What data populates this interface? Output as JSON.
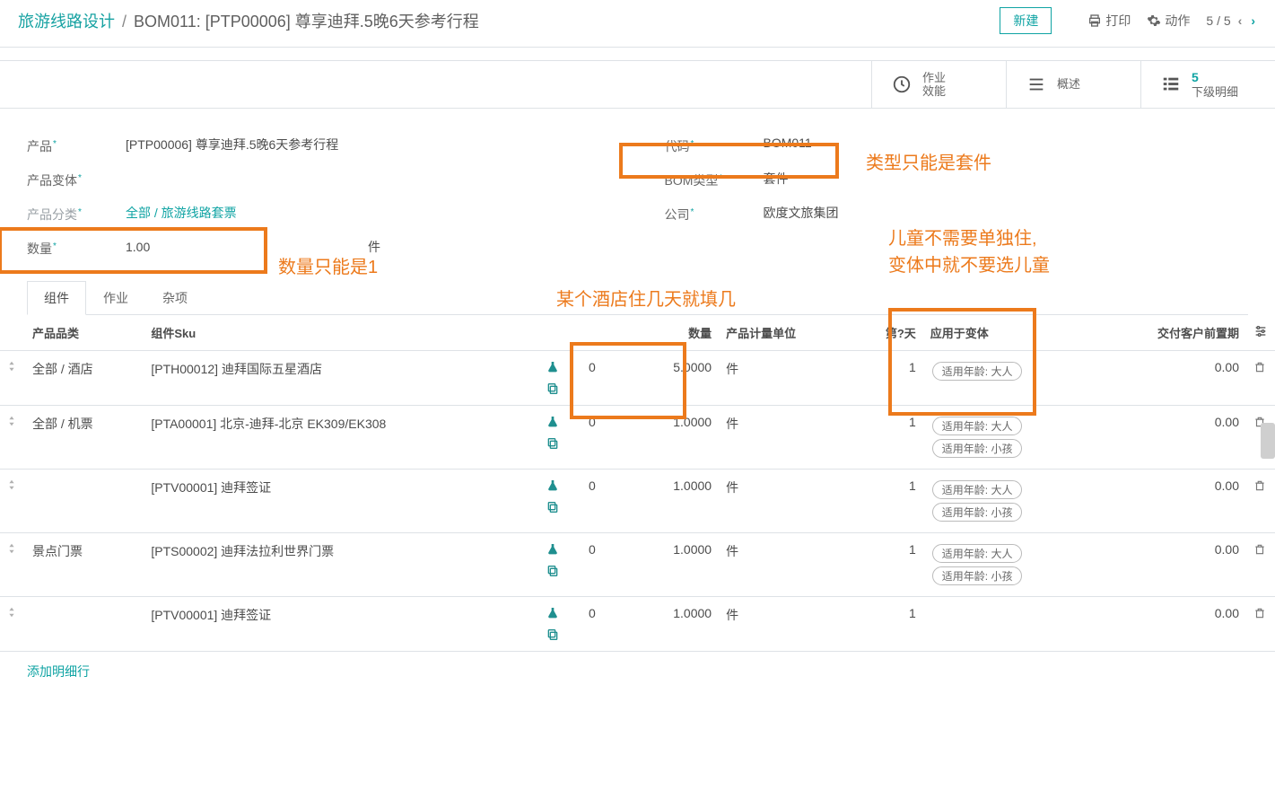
{
  "breadcrumb": {
    "root": "旅游线路设计",
    "sep": "/",
    "title": "BOM011: [PTP00006] 尊享迪拜.5晚6天参考行程"
  },
  "actions": {
    "new": "新建",
    "print": "打印",
    "action": "动作",
    "pager": "5 / 5"
  },
  "statbuttons": {
    "ops": {
      "line1": "作业",
      "line2": "效能"
    },
    "overview": {
      "label": "概述"
    },
    "details": {
      "value": "5",
      "label": "下级明细"
    }
  },
  "fields": {
    "product": {
      "label": "产品",
      "value": "[PTP00006] 尊享迪拜.5晚6天参考行程"
    },
    "variant": {
      "label": "产品变体",
      "value": ""
    },
    "category": {
      "label": "产品分类",
      "value": "全部 / 旅游线路套票"
    },
    "quantity": {
      "label": "数量",
      "value": "1.00",
      "uom": "件"
    },
    "code": {
      "label": "代码",
      "value": "BOM011"
    },
    "bomtype": {
      "label": "BOM类型",
      "value": "套件"
    },
    "company": {
      "label": "公司",
      "value": "欧度文旅集团"
    }
  },
  "annotations": {
    "qty_note": "数量只能是1",
    "bomtype_note": "类型只能是套件",
    "hotel_days_note": "某个酒店住几天就填几",
    "child_note_l1": "儿童不需要单独住,",
    "child_note_l2": "变体中就不要选儿童"
  },
  "tabs": {
    "components": "组件",
    "operations": "作业",
    "misc": "杂项"
  },
  "columns": {
    "category": "产品品类",
    "sku": "组件Sku",
    "qty": "数量",
    "uom": "产品计量单位",
    "day": "第?天",
    "variants": "应用于变体",
    "lead": "交付客户前置期"
  },
  "tags": {
    "adult": "适用年龄: 大人",
    "child": "适用年龄: 小孩"
  },
  "rows": [
    {
      "category": "全部 / 酒店",
      "sku": "[PTH00012] 迪拜国际五星酒店",
      "zero": "0",
      "qty": "5.0000",
      "uom": "件",
      "day": "1",
      "tags": [
        "adult"
      ],
      "lead": "0.00"
    },
    {
      "category": "全部 / 机票",
      "sku": "[PTA00001] 北京-迪拜-北京 EK309/EK308",
      "zero": "0",
      "qty": "1.0000",
      "uom": "件",
      "day": "1",
      "tags": [
        "adult",
        "child"
      ],
      "lead": "0.00"
    },
    {
      "category": "",
      "sku": "[PTV00001] 迪拜签证",
      "zero": "0",
      "qty": "1.0000",
      "uom": "件",
      "day": "1",
      "tags": [
        "adult",
        "child"
      ],
      "lead": "0.00"
    },
    {
      "category": "景点门票",
      "sku": "[PTS00002] 迪拜法拉利世界门票",
      "zero": "0",
      "qty": "1.0000",
      "uom": "件",
      "day": "1",
      "tags": [
        "adult",
        "child"
      ],
      "lead": "0.00"
    },
    {
      "category": "",
      "sku": "[PTV00001] 迪拜签证",
      "zero": "0",
      "qty": "1.0000",
      "uom": "件",
      "day": "1",
      "tags": [],
      "lead": "0.00"
    }
  ],
  "add_line": "添加明细行"
}
